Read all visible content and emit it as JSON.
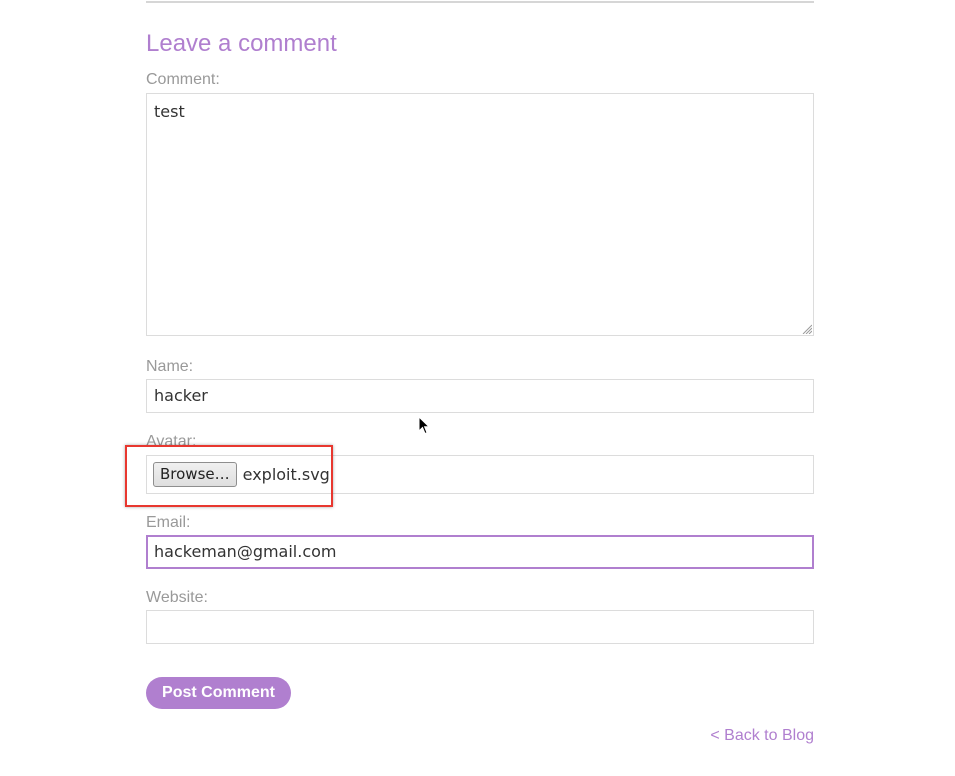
{
  "comment_form": {
    "heading": "Leave a comment",
    "comment_label": "Comment:",
    "comment_value": "test",
    "name_label": "Name:",
    "name_value": "hacker",
    "avatar_label": "Avatar:",
    "browse_label": "Browse…",
    "avatar_file": "exploit.svg",
    "email_label": "Email:",
    "email_value": "hackeman@gmail.com",
    "website_label": "Website:",
    "website_value": "",
    "submit_label": "Post Comment"
  },
  "footer": {
    "back_link": "< Back to Blog"
  },
  "colors": {
    "accent": "#b07fcf",
    "label": "#999999",
    "highlight": "#e8372f"
  },
  "icons": [
    "resize-grip-icon",
    "mouse-cursor-icon"
  ]
}
